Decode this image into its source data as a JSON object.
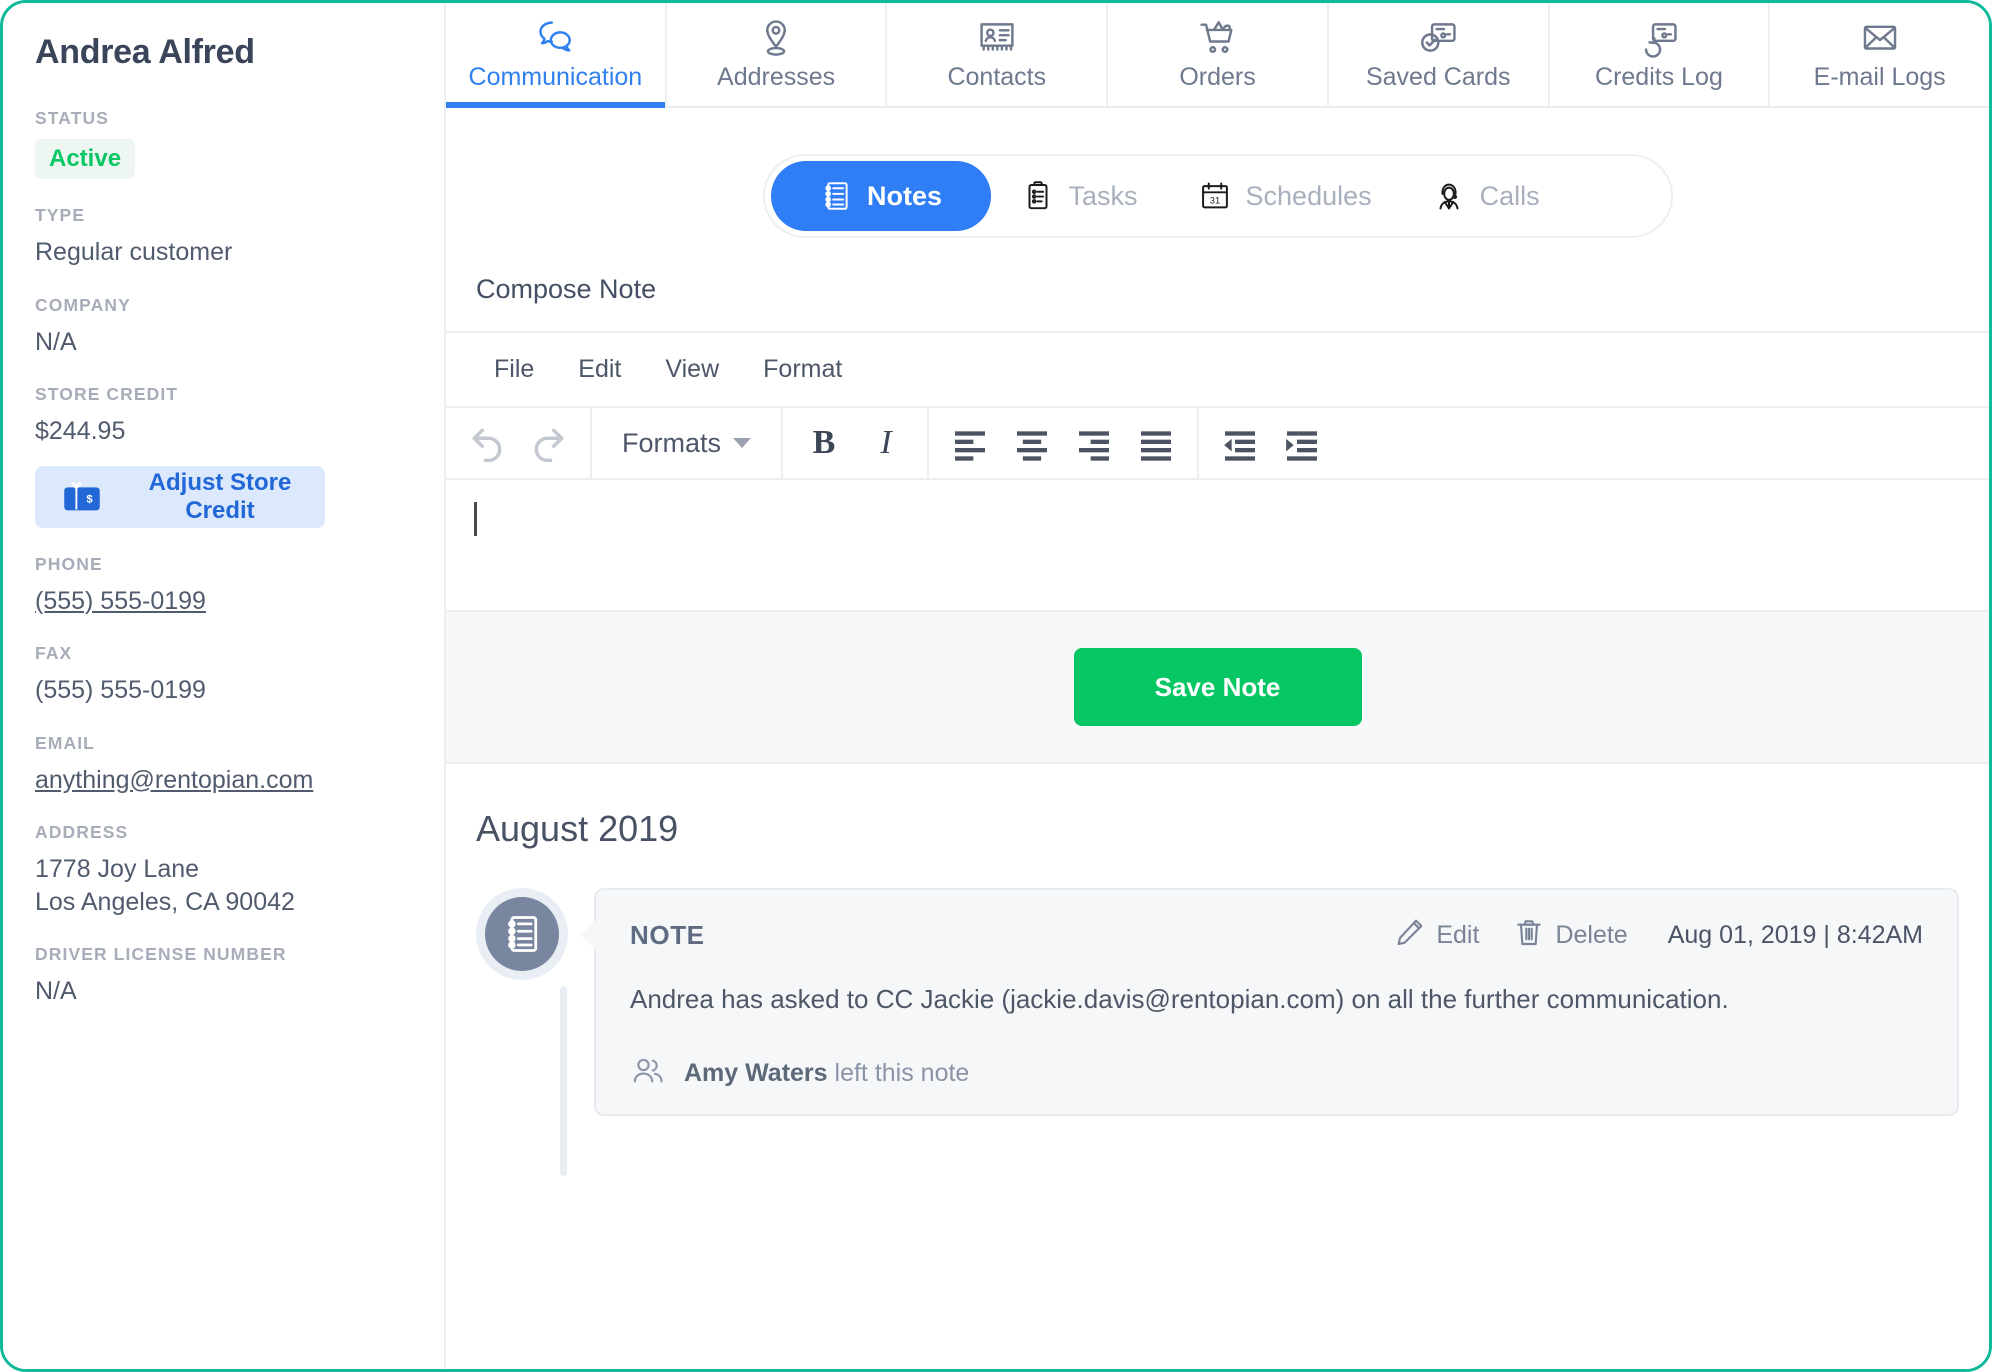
{
  "customer": {
    "name": "Andrea Alfred",
    "fields": [
      {
        "label": "STATUS",
        "value": "Active",
        "kind": "badge"
      },
      {
        "label": "TYPE",
        "value": "Regular customer",
        "kind": "text"
      },
      {
        "label": "COMPANY",
        "value": "N/A",
        "kind": "text"
      },
      {
        "label": "STORE CREDIT",
        "value": "$244.95",
        "kind": "text"
      },
      {
        "label": "PHONE",
        "value": "(555) 555-0199",
        "kind": "link"
      },
      {
        "label": "FAX",
        "value": "(555) 555-0199",
        "kind": "text"
      },
      {
        "label": "EMAIL",
        "value": "anything@rentopian.com",
        "kind": "link"
      },
      {
        "label": "ADDRESS",
        "value": "1778 Joy Lane\nLos Angeles, CA 90042",
        "kind": "text"
      },
      {
        "label": "DRIVER LICENSE NUMBER",
        "value": "N/A",
        "kind": "text"
      }
    ],
    "adjust_credit_label": "Adjust Store Credit",
    "adjust_credit_icon": "gift-card-icon"
  },
  "tabs": [
    {
      "label": "Communication",
      "icon": "speech-bubbles-icon",
      "active": true
    },
    {
      "label": "Addresses",
      "icon": "map-pin-icon",
      "active": false
    },
    {
      "label": "Contacts",
      "icon": "contact-card-icon",
      "active": false
    },
    {
      "label": "Orders",
      "icon": "shopping-cart-icon",
      "active": false
    },
    {
      "label": "Saved Cards",
      "icon": "card-check-icon",
      "active": false
    },
    {
      "label": "Credits Log",
      "icon": "card-refresh-icon",
      "active": false
    },
    {
      "label": "E-mail Logs",
      "icon": "envelope-icon",
      "active": false
    }
  ],
  "segmented": [
    {
      "label": "Notes",
      "icon": "notebook-icon",
      "active": true
    },
    {
      "label": "Tasks",
      "icon": "clipboard-icon",
      "active": false
    },
    {
      "label": "Schedules",
      "icon": "calendar-31-icon",
      "active": false
    },
    {
      "label": "Calls",
      "icon": "headset-agent-icon",
      "active": false
    }
  ],
  "compose": {
    "title": "Compose Note",
    "menu": [
      "File",
      "Edit",
      "View",
      "Format"
    ],
    "toolbar": {
      "undo_icon": "undo-arrow-icon",
      "redo_icon": "redo-arrow-icon",
      "formats_label": "Formats",
      "bold_label": "B",
      "italic_label": "I",
      "align_left_icon": "align-left-icon",
      "align_center_icon": "align-center-icon",
      "align_right_icon": "align-right-icon",
      "align_justify_icon": "align-justify-icon",
      "outdent_icon": "outdent-icon",
      "indent_icon": "indent-icon"
    },
    "editor_value": "",
    "save_label": "Save Note"
  },
  "timeline": {
    "month": "August 2019",
    "entry": {
      "avatar_icon": "notebook-icon",
      "kind": "NOTE",
      "edit_label": "Edit",
      "edit_icon": "pencil-icon",
      "delete_label": "Delete",
      "delete_icon": "trash-icon",
      "timestamp": "Aug 01, 2019 | 8:42AM",
      "body": "Andrea has asked to CC Jackie (jackie.davis@rentopian.com) on all the further communication.",
      "author": "Amy Waters",
      "author_suffix": " left this note",
      "author_icon": "people-icon"
    }
  },
  "colors": {
    "accent_blue": "#3080f0",
    "accent_green": "#06c763",
    "status_green": "#07c862",
    "frame_teal": "#0fb99a",
    "muted": "#a6adb8"
  }
}
